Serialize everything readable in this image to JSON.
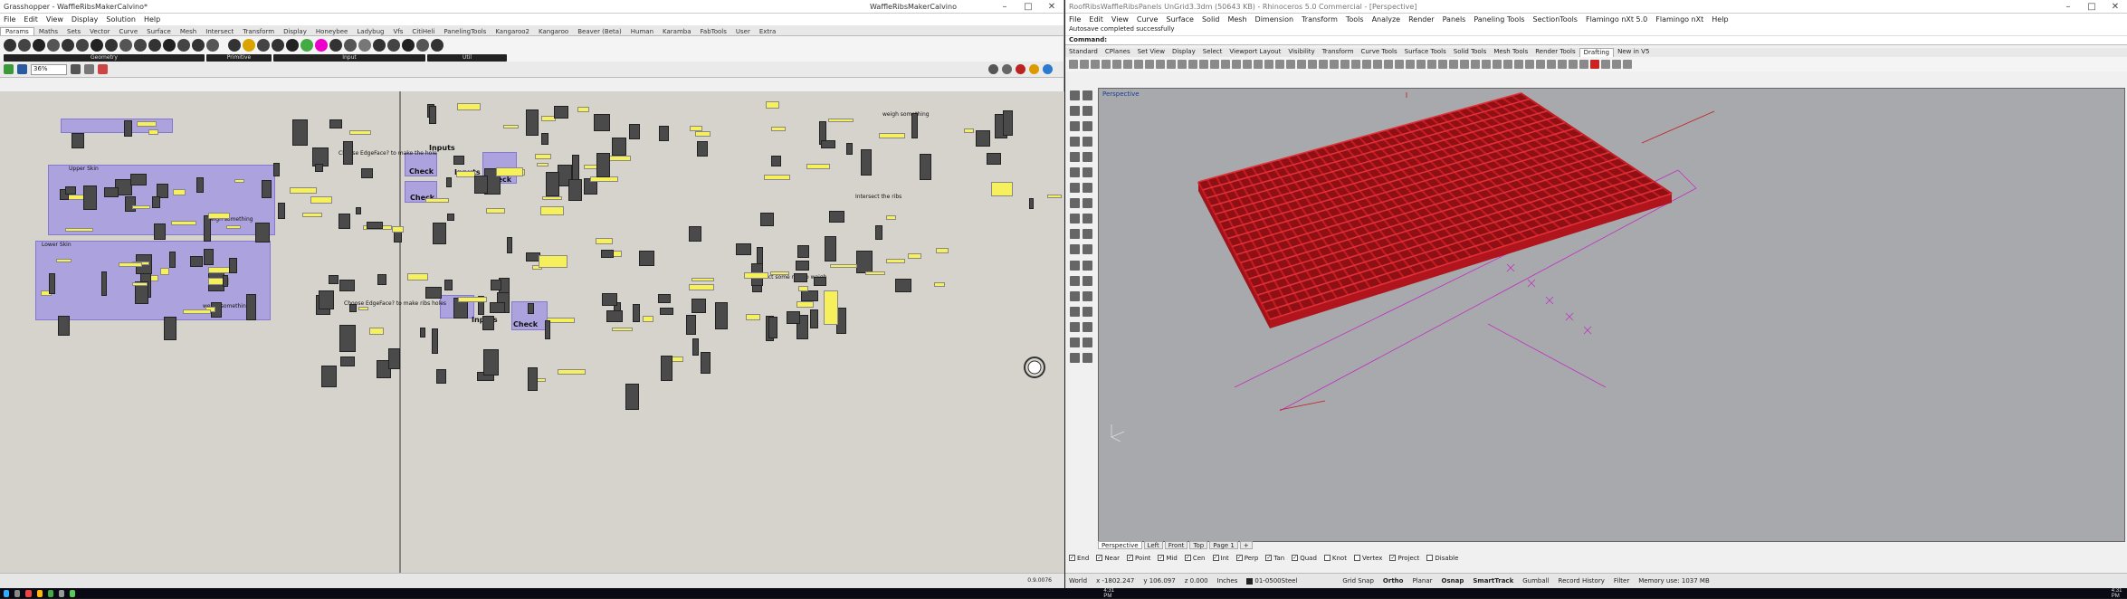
{
  "grasshopper": {
    "title": "Grasshopper - WaffleRibsMakerCalvino*",
    "doc_name": "WaffleRibsMakerCalvino",
    "menu": [
      "File",
      "Edit",
      "View",
      "Display",
      "Solution",
      "Help"
    ],
    "tabs": [
      "Params",
      "Maths",
      "Sets",
      "Vector",
      "Curve",
      "Surface",
      "Mesh",
      "Intersect",
      "Transform",
      "Display",
      "Honeybee",
      "Ladybug",
      "Vfs",
      "CitiHeli",
      "PanelingTools",
      "Kangaroo2",
      "Kangaroo",
      "Beaver (Beta)",
      "Human",
      "Karamba",
      "FabTools",
      "User",
      "Extra"
    ],
    "active_tab": "Params",
    "groups": [
      "Geometry",
      "Primitive",
      "Input",
      "Util"
    ],
    "zoom": "36%",
    "labels": {
      "inputs1": "Inputs",
      "inputs2": "Inputs",
      "inputs3": "Inputs",
      "check1": "Check",
      "check2": "Check",
      "check3": "Check",
      "check4": "Check",
      "upper_skin": "Upper Skin",
      "lower_skin": "Lower Skin",
      "choose_edge1": "Choose EdgeFace? to make the hole",
      "choose_edge2": "Choose EdgeFace? to make ribs holes",
      "intersect_ribs": "Intersect the ribs",
      "select_ribs": "Select some ribs to weigh",
      "weigh1": "weigh something",
      "weigh2": "weigh something",
      "weigh3": "weigh something"
    },
    "status_version": "0.9.0076"
  },
  "rhino": {
    "title": "RoofRibsWaffleRibsPanels UnGrid3.3dm (50643 KB) - Rhinoceros 5.0 Commercial - [Perspective]",
    "menu": [
      "File",
      "Edit",
      "View",
      "Curve",
      "Surface",
      "Solid",
      "Mesh",
      "Dimension",
      "Transform",
      "Tools",
      "Analyze",
      "Render",
      "Panels",
      "Paneling Tools",
      "SectionTools",
      "Flamingo nXt 5.0",
      "Flamingo nXt",
      "Help"
    ],
    "message": "Autosave completed successfully",
    "command_label": "Command:",
    "toolbar_tabs": [
      "Standard",
      "CPlanes",
      "Set View",
      "Display",
      "Select",
      "Viewport Layout",
      "Visibility",
      "Transform",
      "Curve Tools",
      "Surface Tools",
      "Solid Tools",
      "Mesh Tools",
      "Render Tools",
      "Drafting",
      "New in V5"
    ],
    "active_toolbar_tab": "Drafting",
    "viewport_label": "Perspective",
    "view_tabs": [
      "Perspective",
      "Left",
      "Front",
      "Top",
      "Page 1"
    ],
    "active_view_tab": "Perspective",
    "osnaps": [
      {
        "label": "End",
        "checked": true
      },
      {
        "label": "Near",
        "checked": true
      },
      {
        "label": "Point",
        "checked": true
      },
      {
        "label": "Mid",
        "checked": true
      },
      {
        "label": "Cen",
        "checked": true
      },
      {
        "label": "Int",
        "checked": true
      },
      {
        "label": "Perp",
        "checked": true
      },
      {
        "label": "Tan",
        "checked": true
      },
      {
        "label": "Quad",
        "checked": true
      },
      {
        "label": "Knot",
        "checked": false
      },
      {
        "label": "Vertex",
        "checked": false
      },
      {
        "label": "Project",
        "checked": true
      },
      {
        "label": "Disable",
        "checked": false
      }
    ],
    "status": {
      "cplane": "World",
      "x": "x -1802.247",
      "y": "y 106.097",
      "z": "z 0.000",
      "units": "Inches",
      "layer": "01-0500Steel",
      "grid_snap": "Grid Snap",
      "ortho": "Ortho",
      "planar": "Planar",
      "osnap": "Osnap",
      "smarttrack": "SmartTrack",
      "gumball": "Gumball",
      "record_history": "Record History",
      "filter": "Filter",
      "memory": "Memory use: 1037 MB"
    },
    "colors": {
      "ribs": "#c41a22",
      "viewport_bg": "#a7a9ad",
      "curves": "#c030c0"
    }
  },
  "taskbar": {
    "clock_left": "4:31 PM",
    "clock_right": "4:31 PM"
  }
}
